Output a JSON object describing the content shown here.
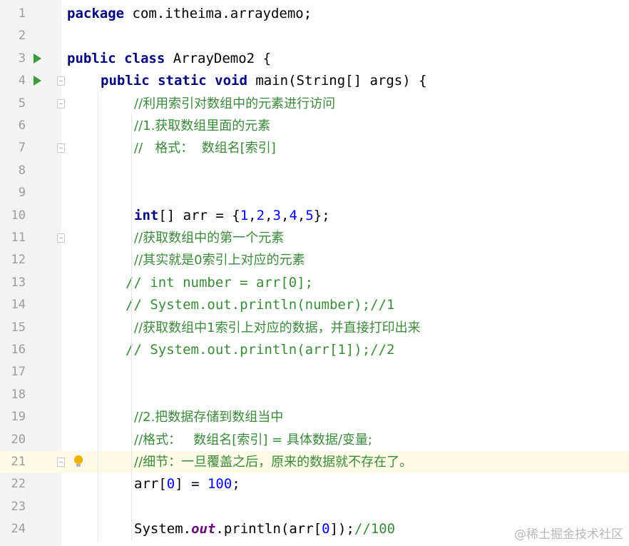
{
  "editor": {
    "lines": [
      {
        "n": "1",
        "parts": [
          [
            "kw",
            "package"
          ],
          [
            "",
            " com.itheima.arraydemo;"
          ]
        ]
      },
      {
        "n": "2",
        "parts": []
      },
      {
        "n": "3",
        "parts": [
          [
            "kw",
            "public"
          ],
          [
            "",
            " "
          ],
          [
            "kw",
            "class"
          ],
          [
            "",
            " ArrayDemo2 {"
          ]
        ]
      },
      {
        "n": "4",
        "parts": [
          [
            "kw",
            "public static void"
          ],
          [
            "",
            " main(String[] args) {"
          ]
        ]
      },
      {
        "n": "5",
        "parts": [
          [
            "cmz",
            "//利用索引对数组中的元素进行访问"
          ]
        ]
      },
      {
        "n": "6",
        "parts": [
          [
            "cmz",
            "//1.获取数组里面的元素"
          ]
        ]
      },
      {
        "n": "7",
        "parts": [
          [
            "cmz",
            "//   格式：  数组名[索引]"
          ]
        ]
      },
      {
        "n": "8",
        "parts": []
      },
      {
        "n": "9",
        "parts": []
      },
      {
        "n": "10",
        "parts": [
          [
            "kw",
            "int"
          ],
          [
            "",
            "[] arr = {"
          ],
          [
            "num",
            "1"
          ],
          [
            "",
            ","
          ],
          [
            "num",
            "2"
          ],
          [
            "",
            ","
          ],
          [
            "num",
            "3"
          ],
          [
            "",
            ","
          ],
          [
            "num",
            "4"
          ],
          [
            "",
            ","
          ],
          [
            "num",
            "5"
          ],
          [
            "",
            "};"
          ]
        ]
      },
      {
        "n": "11",
        "parts": [
          [
            "cmz",
            "//获取数组中的第一个元素"
          ]
        ]
      },
      {
        "n": "12",
        "parts": [
          [
            "cmz",
            "//其实就是0索引上对应的元素"
          ]
        ]
      },
      {
        "n": "13",
        "parts": [
          [
            "cm",
            "// int number = arr[0];"
          ]
        ]
      },
      {
        "n": "14",
        "parts": [
          [
            "cm",
            "// System.out.println(number);//1"
          ]
        ]
      },
      {
        "n": "15",
        "parts": [
          [
            "cmz",
            "//获取数组中1索引上对应的数据，并直接打印出来"
          ]
        ]
      },
      {
        "n": "16",
        "parts": [
          [
            "cm",
            "// System.out.println(arr[1]);//2"
          ]
        ]
      },
      {
        "n": "17",
        "parts": []
      },
      {
        "n": "18",
        "parts": []
      },
      {
        "n": "19",
        "parts": [
          [
            "cmz",
            "//2.把数据存储到数组当中"
          ]
        ]
      },
      {
        "n": "20",
        "parts": [
          [
            "cmz",
            "//格式：   数组名[索引] = 具体数据/变量;"
          ]
        ]
      },
      {
        "n": "21",
        "parts": [
          [
            "cmz",
            "//细节：一旦覆盖之后，原来的数据就不存在了。"
          ]
        ]
      },
      {
        "n": "22",
        "parts": [
          [
            "",
            "arr["
          ],
          [
            "num",
            "0"
          ],
          [
            "",
            "] = "
          ],
          [
            "num",
            "100"
          ],
          [
            "",
            ";"
          ]
        ]
      },
      {
        "n": "23",
        "parts": []
      },
      {
        "n": "24",
        "parts": [
          [
            "",
            "System."
          ],
          [
            "fld",
            "out"
          ],
          [
            "",
            ".println(arr["
          ],
          [
            "num",
            "0"
          ],
          [
            "",
            "]);"
          ],
          [
            "cm",
            "//100"
          ]
        ]
      }
    ],
    "current_line": "21",
    "watermark": "@稀土掘金技术社区",
    "left_strip_letters": [
      "d",
      "d",
      "d"
    ]
  }
}
